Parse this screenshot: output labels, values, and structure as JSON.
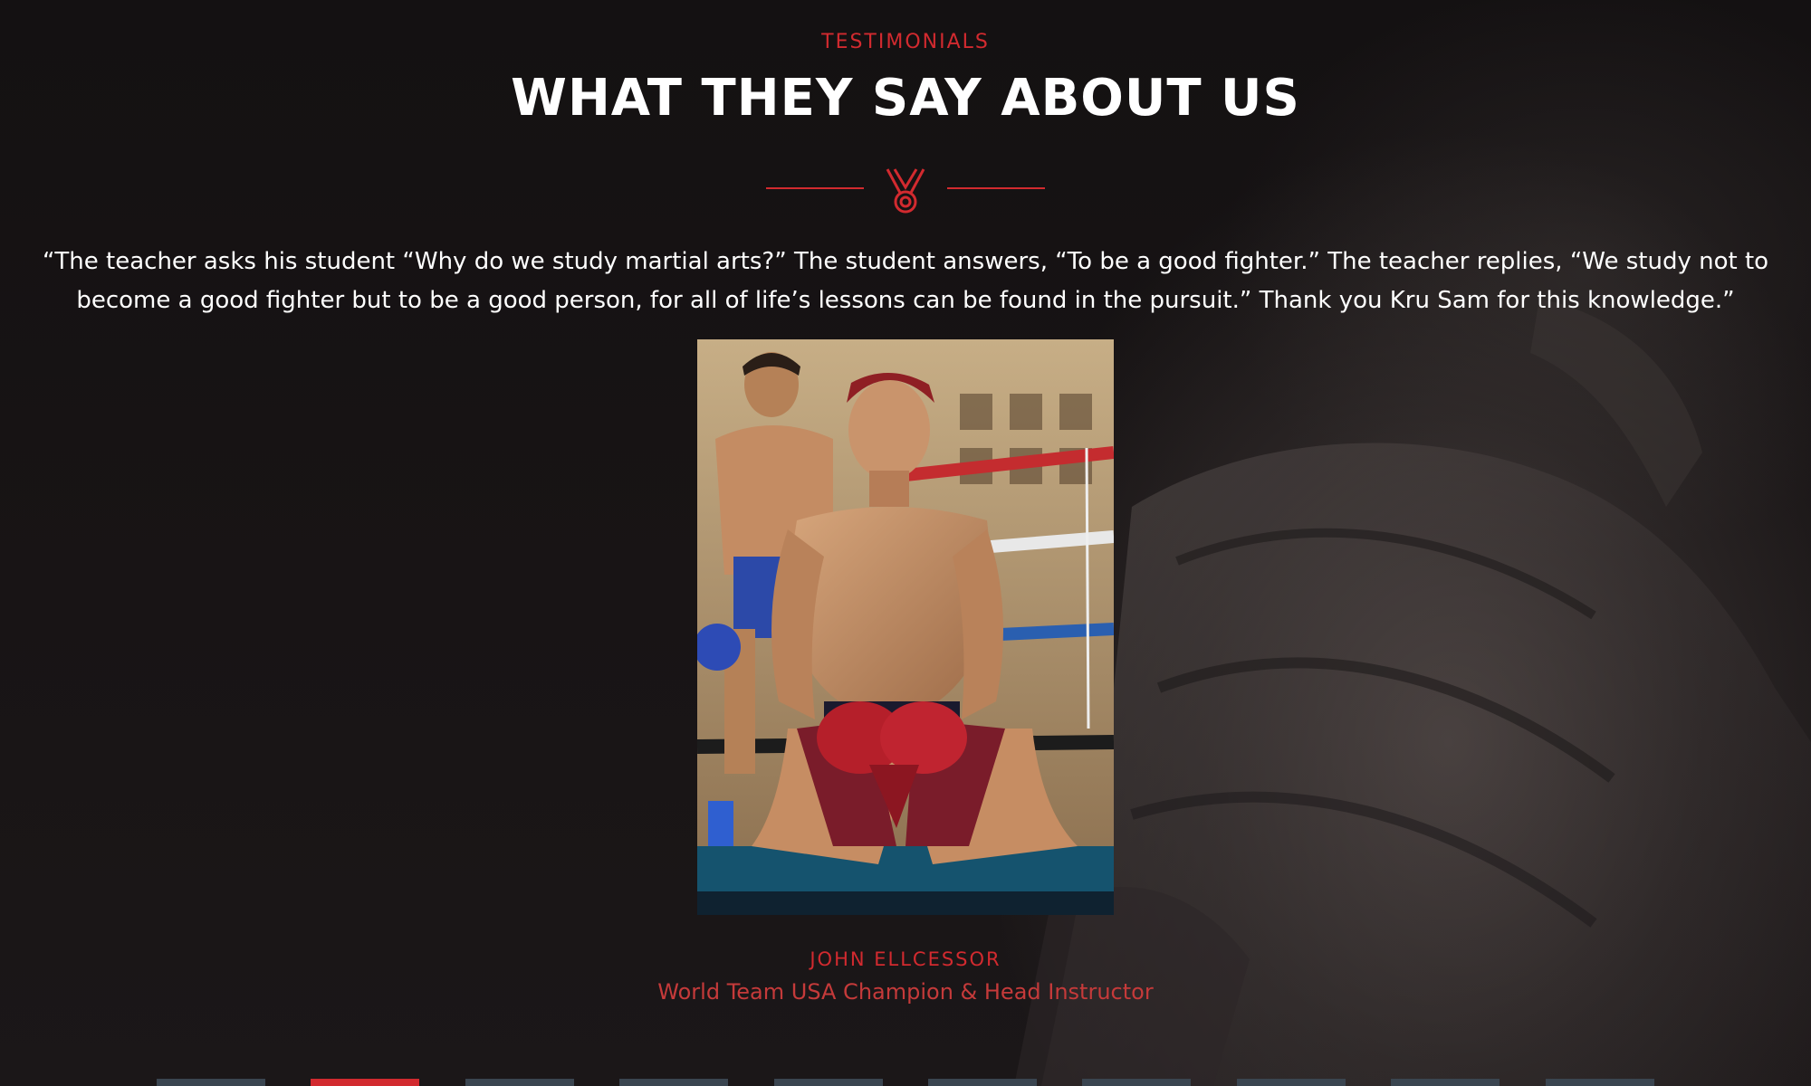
{
  "section": {
    "eyebrow": "TESTIMONIALS",
    "heading": "WHAT THEY SAY ABOUT US",
    "divider_icon": "medal-icon"
  },
  "testimonial": {
    "quote": "“The teacher asks his student “Why do we study martial arts?” The student answers, “To be a good fighter.” The teacher replies, “We study not to become a good fighter but to be a good person, for all of life’s lessons can be found in the pursuit.” Thank you Kru Sam for this knowledge.”",
    "photo_description": "kneeling muay thai fighter in red gloves",
    "author_name": "JOHN ELLCESSOR",
    "author_title": "World Team USA Champion & Head Instructor"
  },
  "pager": {
    "count": 10,
    "active_index": 1
  },
  "colors": {
    "accent": "#d22a2f",
    "background": "#151213",
    "pager_inactive": "#3a4550"
  }
}
